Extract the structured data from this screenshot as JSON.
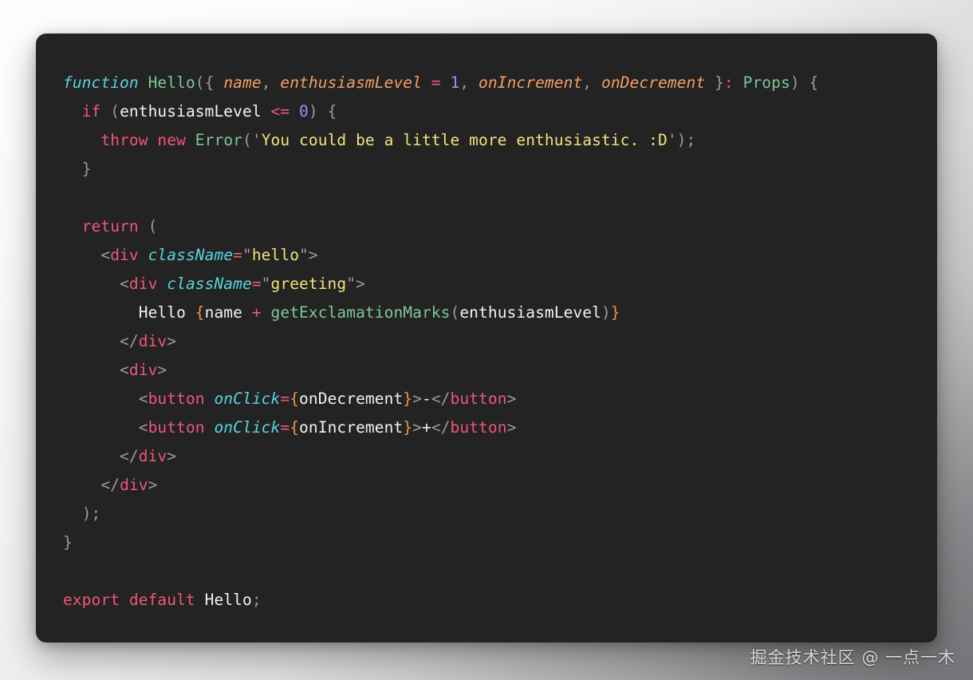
{
  "card": {
    "background_color": "#232323",
    "language": "tsx"
  },
  "backdrop": {
    "gradient_from": "#fafafa",
    "gradient_to": "#87878a"
  },
  "palette": {
    "keyword": "#f0567a",
    "function_keyword": "#56d4e0",
    "type": "#7ec699",
    "parameter": "#f59e63",
    "punctuation": "#9b9b9b",
    "plain": "#f2f2f2",
    "string": "#f2e37a",
    "number": "#a98cf3",
    "operator": "#f0567a",
    "jsx_tag": "#f0567a",
    "jsx_attribute": "#56d4e0",
    "jsx_brace": "#e8954a"
  },
  "watermark": {
    "text": "掘金技术社区 @ 一点一木"
  },
  "code": {
    "raw": "function Hello({ name, enthusiasmLevel = 1, onIncrement, onDecrement }: Props) {\n  if (enthusiasmLevel <= 0) {\n    throw new Error('You could be a little more enthusiastic. :D');\n  }\n\n  return (\n    <div className=\"hello\">\n      <div className=\"greeting\">\n        Hello {name + getExclamationMarks(enthusiasmLevel)}\n      </div>\n      <div>\n        <button onClick={onDecrement}>-</button>\n        <button onClick={onIncrement}>+</button>\n      </div>\n    </div>\n  );\n}\n\nexport default Hello;",
    "line_count": 20,
    "lines": [
      {
        "n": 1,
        "text": "function Hello({ name, enthusiasmLevel = 1, onIncrement, onDecrement }: Props) {",
        "tokens": [
          {
            "t": "function",
            "c": "t-fnkw"
          },
          {
            "t": " ",
            "c": "t-plain"
          },
          {
            "t": "Hello",
            "c": "t-type"
          },
          {
            "t": "(",
            "c": "t-punc"
          },
          {
            "t": "{",
            "c": "t-punc"
          },
          {
            "t": " ",
            "c": "t-plain"
          },
          {
            "t": "name",
            "c": "t-param"
          },
          {
            "t": ",",
            "c": "t-punc"
          },
          {
            "t": " ",
            "c": "t-plain"
          },
          {
            "t": "enthusiasmLevel",
            "c": "t-param"
          },
          {
            "t": " ",
            "c": "t-plain"
          },
          {
            "t": "=",
            "c": "t-op"
          },
          {
            "t": " ",
            "c": "t-plain"
          },
          {
            "t": "1",
            "c": "t-num"
          },
          {
            "t": ",",
            "c": "t-punc"
          },
          {
            "t": " ",
            "c": "t-plain"
          },
          {
            "t": "onIncrement",
            "c": "t-param"
          },
          {
            "t": ",",
            "c": "t-punc"
          },
          {
            "t": " ",
            "c": "t-plain"
          },
          {
            "t": "onDecrement",
            "c": "t-param"
          },
          {
            "t": " ",
            "c": "t-plain"
          },
          {
            "t": "}",
            "c": "t-punc"
          },
          {
            "t": ":",
            "c": "t-op"
          },
          {
            "t": " ",
            "c": "t-plain"
          },
          {
            "t": "Props",
            "c": "t-type"
          },
          {
            "t": ")",
            "c": "t-punc"
          },
          {
            "t": " ",
            "c": "t-plain"
          },
          {
            "t": "{",
            "c": "t-punc"
          }
        ]
      },
      {
        "n": 2,
        "text": "  if (enthusiasmLevel <= 0) {",
        "tokens": [
          {
            "t": "  ",
            "c": "t-plain"
          },
          {
            "t": "if",
            "c": "t-kw"
          },
          {
            "t": " ",
            "c": "t-plain"
          },
          {
            "t": "(",
            "c": "t-punc"
          },
          {
            "t": "enthusiasmLevel",
            "c": "t-plain"
          },
          {
            "t": " ",
            "c": "t-plain"
          },
          {
            "t": "<=",
            "c": "t-op"
          },
          {
            "t": " ",
            "c": "t-plain"
          },
          {
            "t": "0",
            "c": "t-num"
          },
          {
            "t": ")",
            "c": "t-punc"
          },
          {
            "t": " ",
            "c": "t-plain"
          },
          {
            "t": "{",
            "c": "t-punc"
          }
        ]
      },
      {
        "n": 3,
        "text": "    throw new Error('You could be a little more enthusiastic. :D');",
        "tokens": [
          {
            "t": "    ",
            "c": "t-plain"
          },
          {
            "t": "throw",
            "c": "t-kw"
          },
          {
            "t": " ",
            "c": "t-plain"
          },
          {
            "t": "new",
            "c": "t-kw"
          },
          {
            "t": " ",
            "c": "t-plain"
          },
          {
            "t": "Error",
            "c": "t-type"
          },
          {
            "t": "(",
            "c": "t-punc"
          },
          {
            "t": "'",
            "c": "t-quote"
          },
          {
            "t": "You could be a little more enthusiastic. :D",
            "c": "t-str"
          },
          {
            "t": "'",
            "c": "t-quote"
          },
          {
            "t": ")",
            "c": "t-punc"
          },
          {
            "t": ";",
            "c": "t-punc"
          }
        ]
      },
      {
        "n": 4,
        "text": "  }",
        "tokens": [
          {
            "t": "  ",
            "c": "t-plain"
          },
          {
            "t": "}",
            "c": "t-punc"
          }
        ]
      },
      {
        "n": 5,
        "text": "",
        "tokens": []
      },
      {
        "n": 6,
        "text": "  return (",
        "tokens": [
          {
            "t": "  ",
            "c": "t-plain"
          },
          {
            "t": "return",
            "c": "t-kw"
          },
          {
            "t": " ",
            "c": "t-plain"
          },
          {
            "t": "(",
            "c": "t-punc"
          }
        ]
      },
      {
        "n": 7,
        "text": "    <div className=\"hello\">",
        "tokens": [
          {
            "t": "    ",
            "c": "t-plain"
          },
          {
            "t": "<",
            "c": "t-bracket"
          },
          {
            "t": "div",
            "c": "t-tag"
          },
          {
            "t": " ",
            "c": "t-plain"
          },
          {
            "t": "className",
            "c": "t-attr"
          },
          {
            "t": "=",
            "c": "t-op"
          },
          {
            "t": "\"",
            "c": "t-quote"
          },
          {
            "t": "hello",
            "c": "t-str"
          },
          {
            "t": "\"",
            "c": "t-quote"
          },
          {
            "t": ">",
            "c": "t-bracket"
          }
        ]
      },
      {
        "n": 8,
        "text": "      <div className=\"greeting\">",
        "tokens": [
          {
            "t": "      ",
            "c": "t-plain"
          },
          {
            "t": "<",
            "c": "t-bracket"
          },
          {
            "t": "div",
            "c": "t-tag"
          },
          {
            "t": " ",
            "c": "t-plain"
          },
          {
            "t": "className",
            "c": "t-attr"
          },
          {
            "t": "=",
            "c": "t-op"
          },
          {
            "t": "\"",
            "c": "t-quote"
          },
          {
            "t": "greeting",
            "c": "t-str"
          },
          {
            "t": "\"",
            "c": "t-quote"
          },
          {
            "t": ">",
            "c": "t-bracket"
          }
        ]
      },
      {
        "n": 9,
        "text": "        Hello {name + getExclamationMarks(enthusiasmLevel)}",
        "tokens": [
          {
            "t": "        ",
            "c": "t-plain"
          },
          {
            "t": "Hello ",
            "c": "t-plain"
          },
          {
            "t": "{",
            "c": "t-brace"
          },
          {
            "t": "name",
            "c": "t-plain"
          },
          {
            "t": " ",
            "c": "t-plain"
          },
          {
            "t": "+",
            "c": "t-op"
          },
          {
            "t": " ",
            "c": "t-plain"
          },
          {
            "t": "getExclamationMarks",
            "c": "t-type"
          },
          {
            "t": "(",
            "c": "t-punc"
          },
          {
            "t": "enthusiasmLevel",
            "c": "t-plain"
          },
          {
            "t": ")",
            "c": "t-punc"
          },
          {
            "t": "}",
            "c": "t-brace"
          }
        ]
      },
      {
        "n": 10,
        "text": "      </div>",
        "tokens": [
          {
            "t": "      ",
            "c": "t-plain"
          },
          {
            "t": "</",
            "c": "t-bracket"
          },
          {
            "t": "div",
            "c": "t-tag"
          },
          {
            "t": ">",
            "c": "t-bracket"
          }
        ]
      },
      {
        "n": 11,
        "text": "      <div>",
        "tokens": [
          {
            "t": "      ",
            "c": "t-plain"
          },
          {
            "t": "<",
            "c": "t-bracket"
          },
          {
            "t": "div",
            "c": "t-tag"
          },
          {
            "t": ">",
            "c": "t-bracket"
          }
        ]
      },
      {
        "n": 12,
        "text": "        <button onClick={onDecrement}>-</button>",
        "tokens": [
          {
            "t": "        ",
            "c": "t-plain"
          },
          {
            "t": "<",
            "c": "t-bracket"
          },
          {
            "t": "button",
            "c": "t-tag"
          },
          {
            "t": " ",
            "c": "t-plain"
          },
          {
            "t": "onClick",
            "c": "t-attr"
          },
          {
            "t": "=",
            "c": "t-op"
          },
          {
            "t": "{",
            "c": "t-brace"
          },
          {
            "t": "onDecrement",
            "c": "t-plain"
          },
          {
            "t": "}",
            "c": "t-brace"
          },
          {
            "t": ">",
            "c": "t-bracket"
          },
          {
            "t": "-",
            "c": "t-plain"
          },
          {
            "t": "</",
            "c": "t-bracket"
          },
          {
            "t": "button",
            "c": "t-tag"
          },
          {
            "t": ">",
            "c": "t-bracket"
          }
        ]
      },
      {
        "n": 13,
        "text": "        <button onClick={onIncrement}>+</button>",
        "tokens": [
          {
            "t": "        ",
            "c": "t-plain"
          },
          {
            "t": "<",
            "c": "t-bracket"
          },
          {
            "t": "button",
            "c": "t-tag"
          },
          {
            "t": " ",
            "c": "t-plain"
          },
          {
            "t": "onClick",
            "c": "t-attr"
          },
          {
            "t": "=",
            "c": "t-op"
          },
          {
            "t": "{",
            "c": "t-brace"
          },
          {
            "t": "onIncrement",
            "c": "t-plain"
          },
          {
            "t": "}",
            "c": "t-brace"
          },
          {
            "t": ">",
            "c": "t-bracket"
          },
          {
            "t": "+",
            "c": "t-plain"
          },
          {
            "t": "</",
            "c": "t-bracket"
          },
          {
            "t": "button",
            "c": "t-tag"
          },
          {
            "t": ">",
            "c": "t-bracket"
          }
        ]
      },
      {
        "n": 14,
        "text": "      </div>",
        "tokens": [
          {
            "t": "      ",
            "c": "t-plain"
          },
          {
            "t": "</",
            "c": "t-bracket"
          },
          {
            "t": "div",
            "c": "t-tag"
          },
          {
            "t": ">",
            "c": "t-bracket"
          }
        ]
      },
      {
        "n": 15,
        "text": "    </div>",
        "tokens": [
          {
            "t": "    ",
            "c": "t-plain"
          },
          {
            "t": "</",
            "c": "t-bracket"
          },
          {
            "t": "div",
            "c": "t-tag"
          },
          {
            "t": ">",
            "c": "t-bracket"
          }
        ]
      },
      {
        "n": 16,
        "text": "  );",
        "tokens": [
          {
            "t": "  ",
            "c": "t-plain"
          },
          {
            "t": ")",
            "c": "t-punc"
          },
          {
            "t": ";",
            "c": "t-punc"
          }
        ]
      },
      {
        "n": 17,
        "text": "}",
        "tokens": [
          {
            "t": "}",
            "c": "t-punc"
          }
        ]
      },
      {
        "n": 18,
        "text": "",
        "tokens": []
      },
      {
        "n": 19,
        "text": "export default Hello;",
        "tokens": [
          {
            "t": "export",
            "c": "t-kw"
          },
          {
            "t": " ",
            "c": "t-plain"
          },
          {
            "t": "default",
            "c": "t-kw"
          },
          {
            "t": " ",
            "c": "t-plain"
          },
          {
            "t": "Hello",
            "c": "t-plain"
          },
          {
            "t": ";",
            "c": "t-punc"
          }
        ]
      }
    ]
  }
}
